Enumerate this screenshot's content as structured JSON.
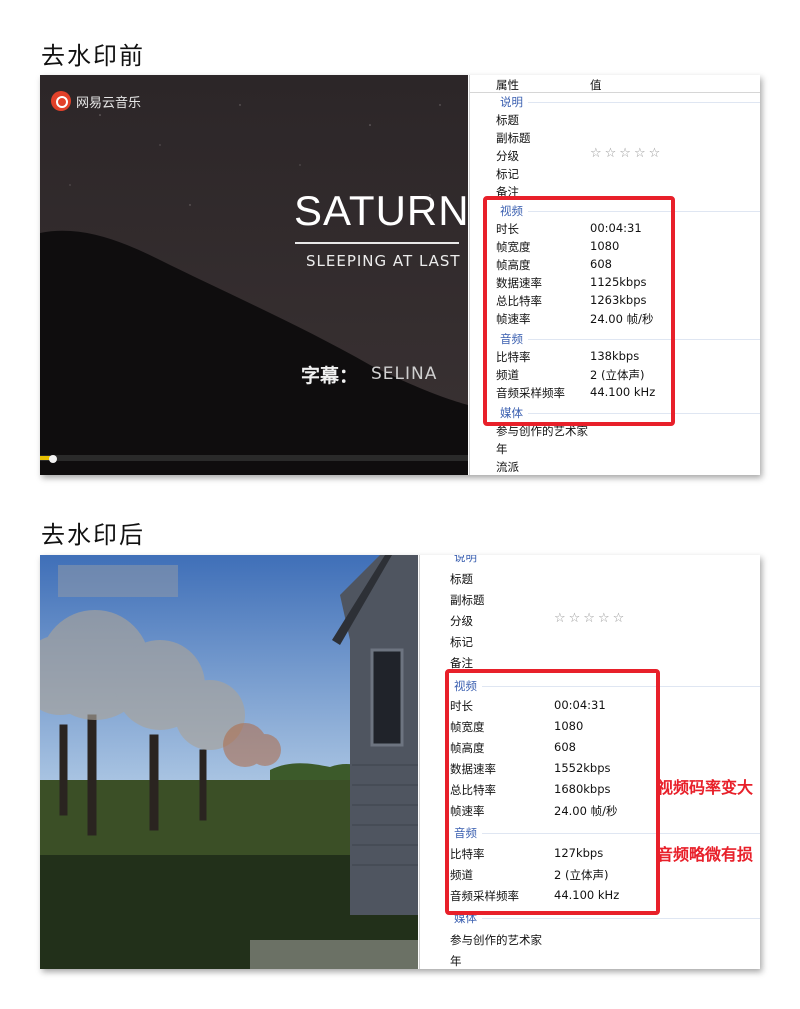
{
  "top": {
    "heading": "去水印前",
    "video": {
      "brand": "网易云音乐",
      "title": "SATURN",
      "subtitle": "SLEEPING AT LAST",
      "credit_prefix": "字幕：",
      "credit_name": "SELINA"
    },
    "panel": {
      "header_property": "属性",
      "header_value": "值",
      "sections": {
        "desc": "说明",
        "video": "视频",
        "audio": "音频",
        "media": "媒体"
      },
      "desc_rows": [
        "标题",
        "副标题",
        "分级",
        "标记",
        "备注"
      ],
      "rating_stars": "☆☆☆☆☆",
      "video_rows": [
        {
          "label": "时长",
          "value": "00:04:31"
        },
        {
          "label": "帧宽度",
          "value": "1080"
        },
        {
          "label": "帧高度",
          "value": "608"
        },
        {
          "label": "数据速率",
          "value": "1125kbps"
        },
        {
          "label": "总比特率",
          "value": "1263kbps"
        },
        {
          "label": "帧速率",
          "value": "24.00 帧/秒"
        }
      ],
      "audio_rows": [
        {
          "label": "比特率",
          "value": "138kbps"
        },
        {
          "label": "频道",
          "value": "2 (立体声)"
        },
        {
          "label": "音频采样频率",
          "value": "44.100 kHz"
        }
      ],
      "media_rows": [
        "参与创作的艺术家",
        "年",
        "流派"
      ]
    }
  },
  "bottom": {
    "heading": "去水印后",
    "panel": {
      "sections": {
        "desc": "说明",
        "video": "视频",
        "audio": "音频",
        "media": "媒体"
      },
      "desc_rows": [
        "标题",
        "副标题",
        "分级",
        "标记",
        "备注"
      ],
      "rating_stars": "☆☆☆☆☆",
      "video_rows": [
        {
          "label": "时长",
          "value": "00:04:31"
        },
        {
          "label": "帧宽度",
          "value": "1080"
        },
        {
          "label": "帧高度",
          "value": "608"
        },
        {
          "label": "数据速率",
          "value": "1552kbps"
        },
        {
          "label": "总比特率",
          "value": "1680kbps"
        },
        {
          "label": "帧速率",
          "value": "24.00 帧/秒"
        }
      ],
      "audio_rows": [
        {
          "label": "比特率",
          "value": "127kbps"
        },
        {
          "label": "频道",
          "value": "2 (立体声)"
        },
        {
          "label": "音频采样频率",
          "value": "44.100 kHz"
        }
      ],
      "media_rows": [
        "参与创作的艺术家",
        "年"
      ]
    },
    "annotations": {
      "video_note": "视频码率变大",
      "audio_note": "音频略微有损"
    }
  },
  "colors": {
    "highlight_red": "#e8202a",
    "section_blue": "#3a5fb0",
    "brand_red": "#e2412a"
  }
}
